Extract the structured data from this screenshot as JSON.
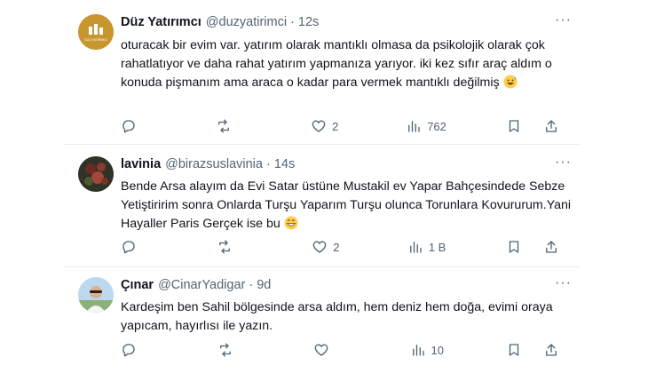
{
  "tweets": [
    {
      "name": "Düz Yatırımcı",
      "handle": "@duzyatirimci",
      "time": "12s",
      "avatar_text": "DÜZ YATIRIMCI",
      "text": "oturacak bir evim var. yatırım olarak mantıklı olmasa da psikolojik olarak çok rahatlatıyor ve daha rahat yatırım yapmanıza yarıyor. iki kez sıfır araç aldım o konuda pişmanım ama araca o kadar para vermek mantıklı değilmiş",
      "emoji": "sweat-smile-emoji",
      "reply_count": "",
      "retweet_count": "",
      "like_count": "2",
      "view_count": "762"
    },
    {
      "name": "lavinia",
      "handle": "@birazsuslavinia",
      "time": "14s",
      "text": "Bende Arsa alayım da Evi Satar üstüne Mustakil ev Yapar Bahçesindede Sebze Yetiştiririm sonra Onlarda Turşu Yaparım Turşu olunca Torunlara Kovururum.Yani Hayaller Paris Gerçek ise bu",
      "emoji": "grin-emoji",
      "reply_count": "",
      "retweet_count": "",
      "like_count": "2",
      "view_count": "1 B"
    },
    {
      "name": "Çınar",
      "handle": "@CinarYadigar",
      "time": "9d",
      "text": "Kardeşim ben Sahil bölgesinde arsa aldım, hem deniz hem doğa, evimi oraya yapıcam, hayırlısı ile yazın.",
      "reply_count": "",
      "retweet_count": "",
      "like_count": "",
      "view_count": "10"
    }
  ],
  "more_glyph": "···",
  "separator": "·",
  "colors": {
    "text": "#0f1419",
    "secondary": "#536471",
    "divider": "#e7e9ea",
    "avatar1": "#c8962f"
  }
}
